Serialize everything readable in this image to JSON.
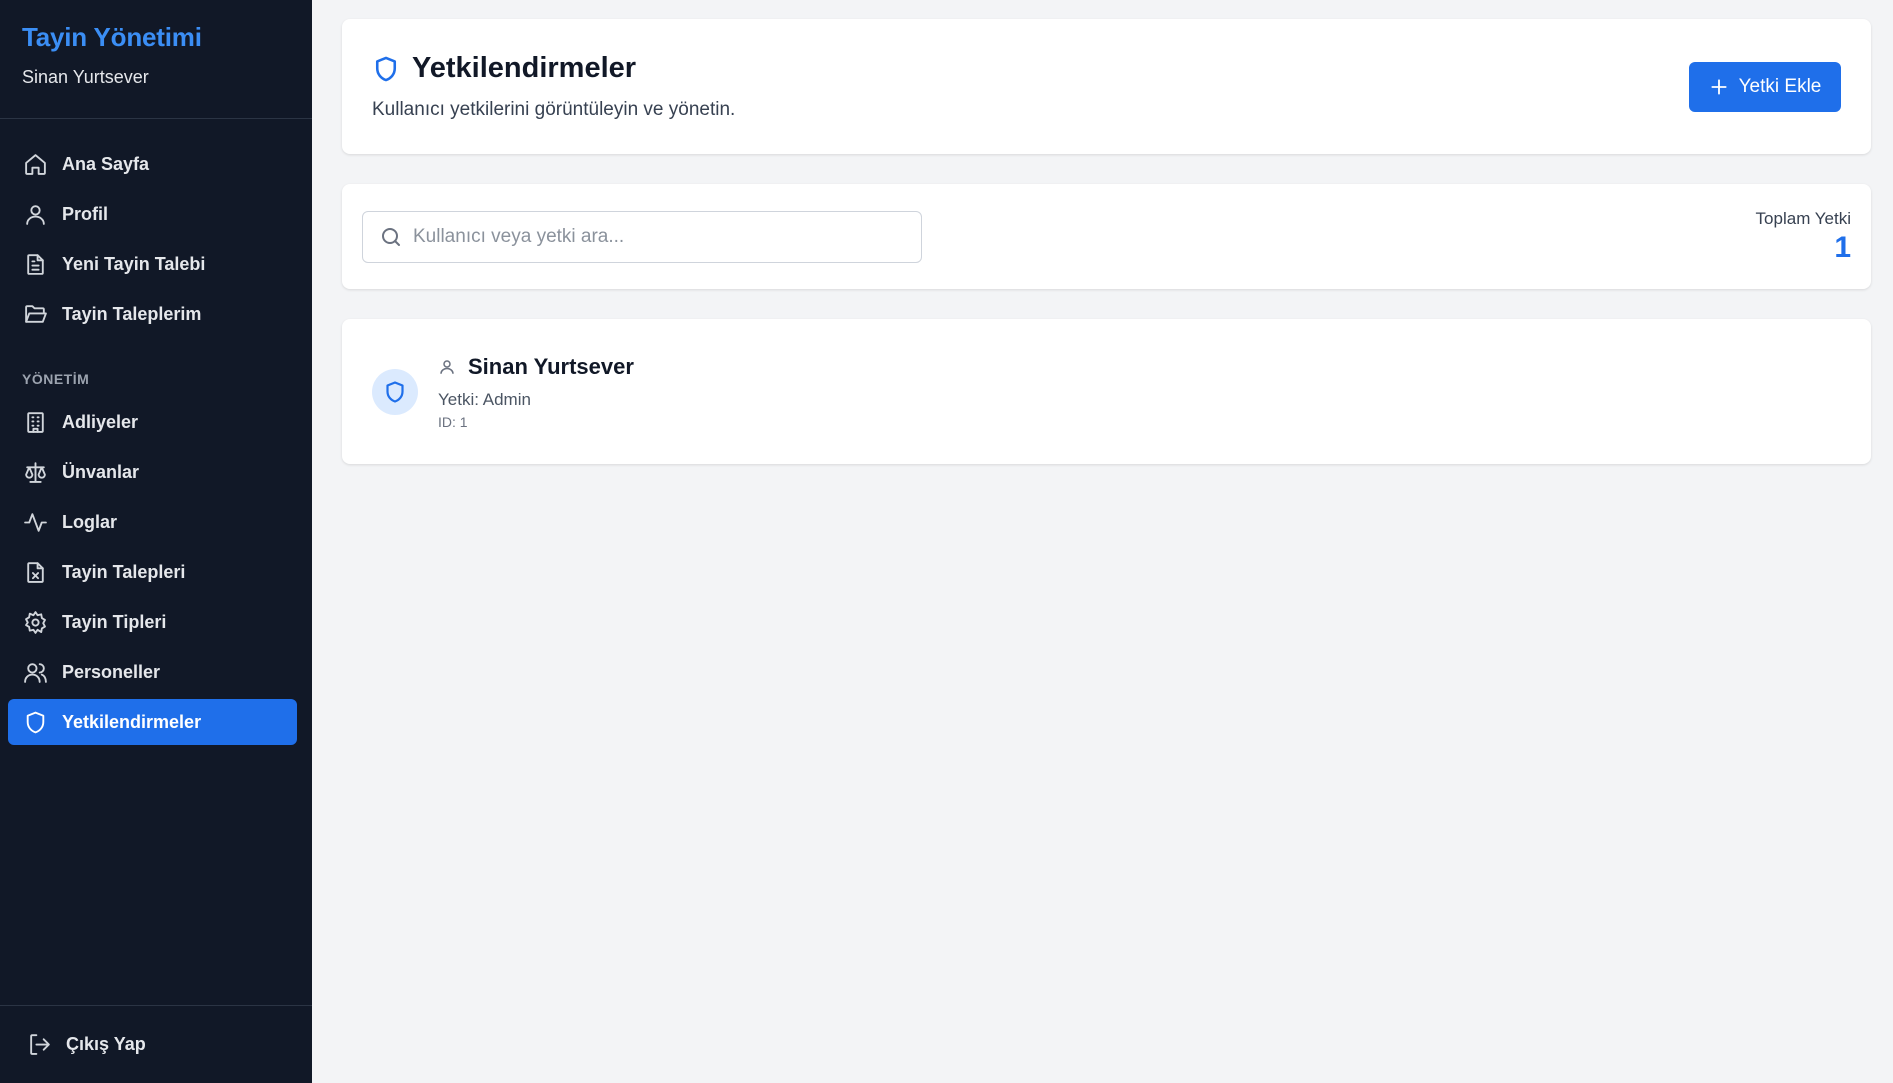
{
  "sidebar": {
    "brand_title": "Tayin Yönetimi",
    "user_name": "Sinan Yurtsever",
    "items": [
      {
        "label": "Ana Sayfa",
        "icon": "home-icon"
      },
      {
        "label": "Profil",
        "icon": "user-icon"
      },
      {
        "label": "Yeni Tayin Talebi",
        "icon": "document-icon"
      },
      {
        "label": "Tayin Taleplerim",
        "icon": "folder-open-icon"
      }
    ],
    "section_label": "YÖNETİM",
    "admin_items": [
      {
        "label": "Adliyeler",
        "icon": "building-icon"
      },
      {
        "label": "Ünvanlar",
        "icon": "scale-icon"
      },
      {
        "label": "Loglar",
        "icon": "activity-icon"
      },
      {
        "label": "Tayin Talepleri",
        "icon": "file-x-icon"
      },
      {
        "label": "Tayin Tipleri",
        "icon": "gear-icon"
      },
      {
        "label": "Personeller",
        "icon": "users-icon"
      },
      {
        "label": "Yetkilendirmeler",
        "icon": "shield-icon",
        "active": true
      }
    ],
    "logout_label": "Çıkış Yap"
  },
  "header": {
    "title": "Yetkilendirmeler",
    "subtitle": "Kullanıcı yetkilerini görüntüleyin ve yönetin.",
    "add_button_label": "Yetki Ekle"
  },
  "search": {
    "placeholder": "Kullanıcı veya yetki ara...",
    "value": ""
  },
  "stats": {
    "total_label": "Toplam Yetki",
    "total_value": "1"
  },
  "permissions": [
    {
      "user_name": "Sinan Yurtsever",
      "role_text": "Yetki: Admin",
      "id_text": "ID: 1"
    }
  ],
  "colors": {
    "sidebar_bg": "#111827",
    "accent": "#1f6fea",
    "brand_title": "#3b8ef5",
    "page_bg": "#f3f4f6"
  }
}
